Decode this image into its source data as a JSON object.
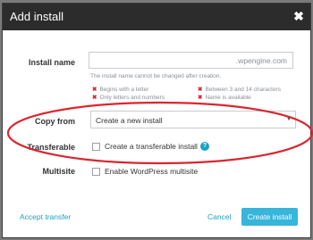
{
  "dialog": {
    "title": "Add install",
    "close_glyph": "✖"
  },
  "form": {
    "install_name": {
      "label": "Install name",
      "value": "",
      "suffix": ".wpengine.com",
      "help": "The install name cannot be changed after creation."
    },
    "rules": [
      {
        "text": "Begins with a letter",
        "status": "invalid"
      },
      {
        "text": "Only letters and numbers",
        "status": "invalid"
      },
      {
        "text": "Between 3 and 14 characters",
        "status": "invalid"
      },
      {
        "text": "Name is available",
        "status": "invalid"
      }
    ],
    "copy_from": {
      "label": "Copy from",
      "selected": "Create a new install"
    },
    "transferable": {
      "label": "Transferable",
      "option": "Create a transferable install",
      "checked": false,
      "help_icon": "help-icon"
    },
    "multisite": {
      "label": "Multisite",
      "option": "Enable WordPress multisite",
      "checked": false
    }
  },
  "footer": {
    "accept_transfer": "Accept transfer",
    "cancel": "Cancel",
    "create": "Create install"
  },
  "colors": {
    "accent": "#37b5da",
    "link": "#19a2c8",
    "error": "#d9262f",
    "annotation": "#d9262f",
    "header": "#2c2c2c"
  }
}
